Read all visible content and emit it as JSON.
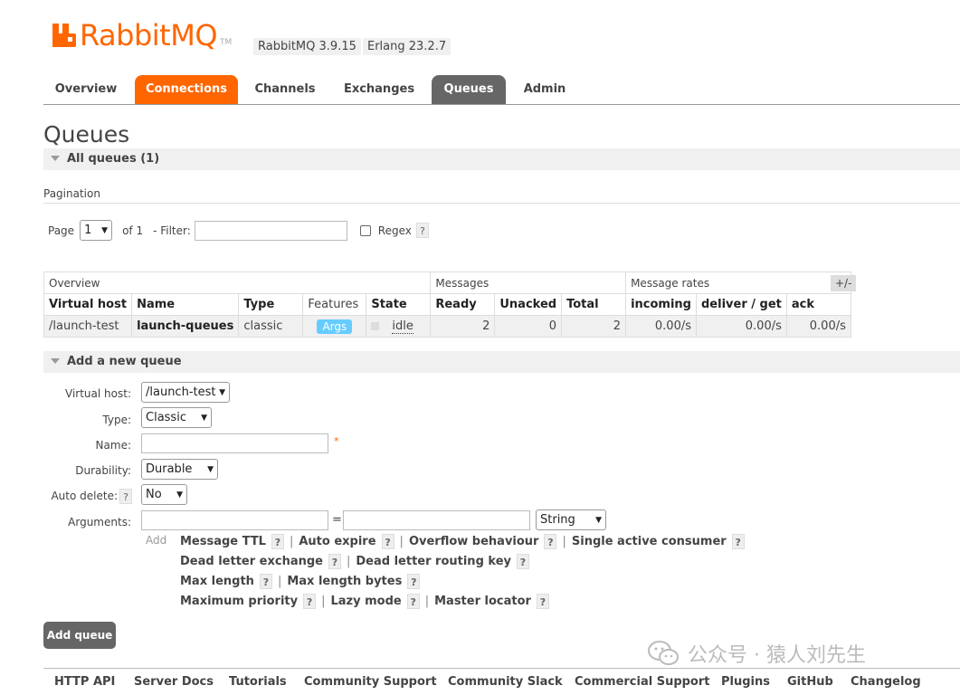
{
  "header": {
    "logo_text": "RabbitMQ",
    "logo_tm": "TM",
    "version": "RabbitMQ 3.9.15",
    "erlang": "Erlang 23.2.7"
  },
  "tabs": [
    {
      "label": "Overview"
    },
    {
      "label": "Connections"
    },
    {
      "label": "Channels"
    },
    {
      "label": "Exchanges"
    },
    {
      "label": "Queues"
    },
    {
      "label": "Admin"
    }
  ],
  "page_title": "Queues",
  "all_queues": "All queues (1)",
  "pagination": {
    "label": "Pagination",
    "page_label": "Page",
    "page_value": "1",
    "of_label": "of 1",
    "filter_label": "- Filter:",
    "filter_value": "",
    "regex_label": "Regex",
    "help": "?"
  },
  "table": {
    "groups": [
      "Overview",
      "Messages",
      "Message rates"
    ],
    "columns": [
      "Virtual host",
      "Name",
      "Type",
      "Features",
      "State",
      "Ready",
      "Unacked",
      "Total",
      "incoming",
      "deliver / get",
      "ack"
    ],
    "row": {
      "vhost": "/launch-test",
      "name": "launch-queues",
      "type": "classic",
      "features": "Args",
      "state": "idle",
      "ready": "2",
      "unacked": "0",
      "total": "2",
      "incoming": "0.00/s",
      "deliver_get": "0.00/s",
      "ack": "0.00/s"
    },
    "plus_minus": "+/-"
  },
  "add_queue": {
    "section": "Add a new queue",
    "vhost_label": "Virtual host:",
    "vhost_value": "/launch-test",
    "type_label": "Type:",
    "type_value": "Classic",
    "name_label": "Name:",
    "name_value": "",
    "required_mark": "*",
    "durability_label": "Durability:",
    "durability_value": "Durable",
    "autodelete_label": "Auto delete:",
    "autodelete_value": "No",
    "arguments_label": "Arguments:",
    "equals": "=",
    "arg_type_value": "String",
    "add_label": "Add",
    "arg_links": {
      "row1": [
        "Message TTL",
        "Auto expire",
        "Overflow behaviour",
        "Single active consumer"
      ],
      "row2": [
        "Dead letter exchange",
        "Dead letter routing key"
      ],
      "row3": [
        "Max length",
        "Max length bytes"
      ],
      "row4": [
        "Maximum priority",
        "Lazy mode",
        "Master locator"
      ]
    },
    "sep": "|",
    "button": "Add queue"
  },
  "footer": [
    "HTTP API",
    "Server Docs",
    "Tutorials",
    "Community Support",
    "Community Slack",
    "Commercial Support",
    "Plugins",
    "GitHub",
    "Changelog"
  ],
  "watermark": "公众号 · 猿人刘先生",
  "colors": {
    "brand": "#ff6600",
    "active_tab": "#666666",
    "badge": "#66ccff"
  }
}
